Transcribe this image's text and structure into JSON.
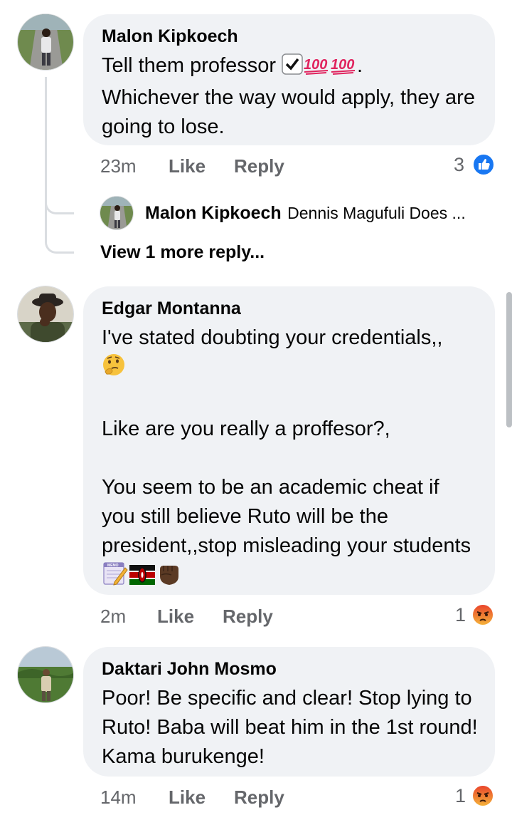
{
  "comments": [
    {
      "author": "Malon Kipkoech",
      "text_line1": "Tell them professor ",
      "text_line1_suffix": ".",
      "text_rest": "Whichever the way would apply, they are going to lose.",
      "time": "23m",
      "like_label": "Like",
      "reply_label": "Reply",
      "reaction_count": "3",
      "reaction_icon": "like-reaction-icon"
    },
    {
      "author": "Edgar Montanna",
      "text_p1": "I've stated doubting your credentials,,",
      "text_p2": "Like are you really a proffesor?,",
      "text_p3": "You seem to be an academic cheat if you still believe Ruto will be the president,,stop misleading your students",
      "time": "2m",
      "like_label": "Like",
      "reply_label": "Reply",
      "reaction_count": "1",
      "reaction_icon": "angry-reaction-icon"
    },
    {
      "author": "Daktari John Mosmo",
      "text": "Poor! Be specific and clear! Stop lying to Ruto! Baba will beat him in the 1st round! Kama burukenge!",
      "time": "14m",
      "like_label": "Like",
      "reply_label": "Reply",
      "reaction_count": "1",
      "reaction_icon": "angry-reaction-icon"
    }
  ],
  "reply_preview": {
    "author": "Malon Kipkoech",
    "snippet": "Dennis Magufuli Does ..."
  },
  "view_more": "View 1 more reply...",
  "colors": {
    "bubble": "#f0f2f5",
    "meta_text": "#65676b",
    "like_blue": "#1877f2",
    "angry_orange": "#e9710f",
    "hundred_red": "#e0245e"
  }
}
